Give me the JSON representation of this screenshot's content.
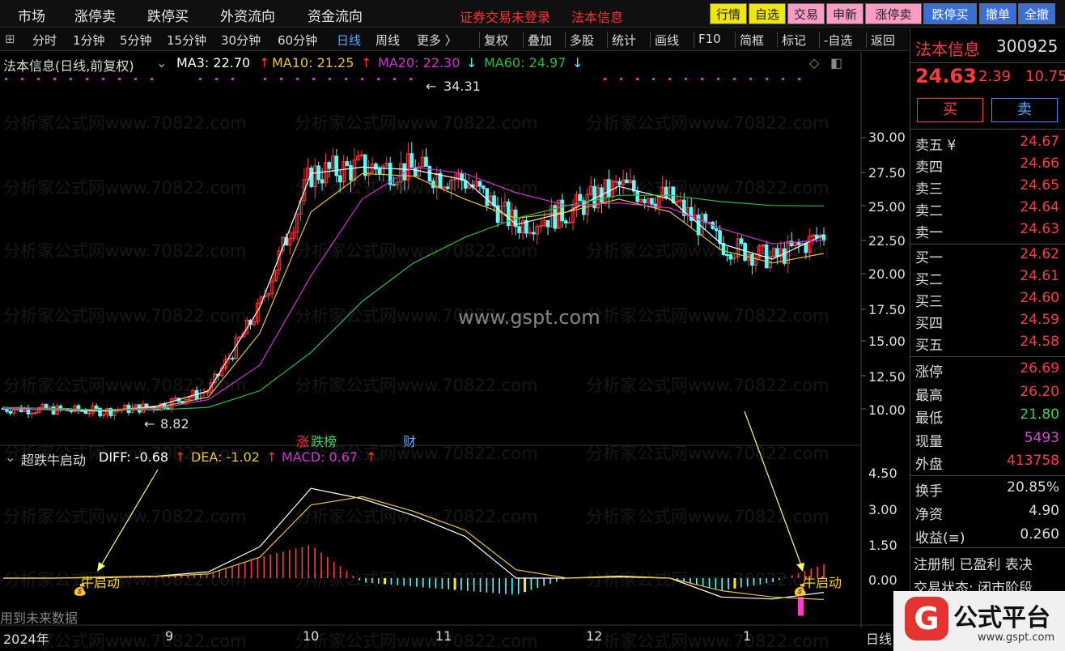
{
  "top_menu": [
    "市场",
    "涨停卖",
    "跌停买",
    "外资流向",
    "资金流向"
  ],
  "status": {
    "login": "证券交易未登录",
    "stock": "法本信息"
  },
  "top_buttons": [
    {
      "label": "行情",
      "color": "#222",
      "bg": "#f1e60a"
    },
    {
      "label": "自选",
      "color": "#222",
      "bg": "#f1e60a"
    },
    {
      "label": "交易",
      "color": "#222",
      "bg": "#ff9bc4"
    },
    {
      "label": "申新",
      "color": "#222",
      "bg": "#ff9bc4"
    },
    {
      "label": "涨停卖",
      "color": "#222",
      "bg": "#ff9bc4"
    },
    {
      "label": "跌停买",
      "color": "#fff",
      "bg": "#3a6fd8"
    },
    {
      "label": "撤单",
      "color": "#fff",
      "bg": "#3a6fd8"
    },
    {
      "label": "全撤",
      "color": "#fff",
      "bg": "#3a6fd8"
    }
  ],
  "toolbar": {
    "periods": [
      "分时",
      "1分钟",
      "5分钟",
      "15分钟",
      "30分钟",
      "60分钟",
      "日线",
      "周线",
      "更多 〉"
    ],
    "active": "日线",
    "tools": [
      "复权",
      "叠加",
      "多股",
      "统计",
      "画线",
      "F10",
      "简框",
      "标记",
      "-自选",
      "返回"
    ]
  },
  "chart_header": {
    "title": "法本信息(日线,前复权)",
    "ma3": "MA3: 22.70",
    "ma10": "MA10: 21.25",
    "ma20": "MA20: 22.30",
    "ma60": "MA60: 24.97"
  },
  "annotations": {
    "high": "34.31",
    "low": "8.82",
    "zdb_1": "涨",
    "zdb_2": "跌榜",
    "cai": "财",
    "bull_left": "牛启动",
    "bull_right": "牛启动",
    "future_note": "用到未来数据"
  },
  "macd_header": {
    "name": "超跌牛启动",
    "diff": "DIFF: -0.68",
    "dea": "DEA: -1.02",
    "macd": "MACD: 0.67"
  },
  "price_axis": [
    "30.00",
    "27.50",
    "25.00",
    "22.50",
    "20.00",
    "17.50",
    "15.00",
    "12.50",
    "10.00"
  ],
  "macd_axis": [
    "4.50",
    "3.00",
    "1.50",
    "0.00"
  ],
  "x_axis": [
    "2024年",
    "9",
    "10",
    "11",
    "12",
    "1"
  ],
  "period_label": "日线",
  "watermark_text": "分析家公式网www.70822.com",
  "center_watermark": "www.gspt.com",
  "right_panel": {
    "name": "法本信息",
    "code": "300925",
    "price": "24.63",
    "change": "2.39",
    "pct": "10.75",
    "buy_btn": "买",
    "sell_btn": "卖",
    "asks": [
      {
        "label": "卖五 ¥",
        "val": "24.67"
      },
      {
        "label": "卖四",
        "val": "24.66"
      },
      {
        "label": "卖三",
        "val": "24.65"
      },
      {
        "label": "卖二",
        "val": "24.64"
      },
      {
        "label": "卖一",
        "val": "24.63"
      }
    ],
    "bids": [
      {
        "label": "买一",
        "val": "24.62"
      },
      {
        "label": "买二",
        "val": "24.61"
      },
      {
        "label": "买三",
        "val": "24.60"
      },
      {
        "label": "买四",
        "val": "24.59"
      },
      {
        "label": "买五",
        "val": "24.58"
      }
    ],
    "stats": [
      {
        "label": "涨停",
        "val": "26.69",
        "color": "#ff3b3b"
      },
      {
        "label": "最高",
        "val": "26.20",
        "color": "#ff3b3b"
      },
      {
        "label": "最低",
        "val": "21.80",
        "color": "#2fd35a"
      },
      {
        "label": "现量",
        "val": "5493",
        "color": "#d24bd2"
      },
      {
        "label": "外盘",
        "val": "413758",
        "color": "#ff3b3b"
      }
    ],
    "stats2": [
      {
        "label": "换手",
        "val": "20.85%"
      },
      {
        "label": "净资",
        "val": "4.90"
      },
      {
        "label": "收益(≡)",
        "val": "0.260"
      }
    ],
    "reg": "注册制 已盈利 表决",
    "trade_state": "交易状态: 闭市阶段"
  },
  "logo": {
    "glyph": "G",
    "text": "公式平台",
    "url": "www.gspt.com"
  },
  "colors": {
    "up": "#ff3b3b",
    "down": "#54ffff",
    "ma3": "#ffffff",
    "ma10": "#e8c22a",
    "ma20": "#d12fd1",
    "ma60": "#1fbf3a"
  },
  "chart_data": [
    {
      "type": "line",
      "title": "法本信息(日线,前复权)",
      "ylim": [
        8,
        35
      ],
      "x": [
        "2024年",
        "9",
        "10",
        "11",
        "12",
        "1"
      ],
      "series": [
        {
          "name": "MA3",
          "values": [
            9.1,
            9.0,
            8.9,
            9.3,
            10.5,
            17.0,
            27.5,
            28.0,
            27.8,
            27.0,
            23.5,
            24.5,
            26.5,
            25.5,
            22.0,
            20.8,
            22.7
          ]
        },
        {
          "name": "MA10",
          "values": [
            9.1,
            9.0,
            9.0,
            9.2,
            10.0,
            15.0,
            24.5,
            27.5,
            27.3,
            25.5,
            24.0,
            24.5,
            25.5,
            24.5,
            21.5,
            20.5,
            21.25
          ]
        },
        {
          "name": "MA20",
          "values": [
            9.1,
            9.0,
            9.0,
            9.1,
            9.8,
            12.5,
            19.5,
            25.5,
            28.0,
            27.5,
            26.0,
            25.0,
            25.2,
            24.8,
            23.2,
            22.0,
            22.3
          ]
        },
        {
          "name": "MA60",
          "values": [
            9.2,
            9.1,
            9.0,
            9.0,
            9.2,
            10.5,
            13.5,
            17.5,
            20.5,
            22.5,
            24.0,
            25.0,
            25.8,
            25.8,
            25.3,
            25.0,
            24.97
          ]
        }
      ],
      "annotations": {
        "high": 34.31,
        "low": 8.82
      }
    },
    {
      "type": "line",
      "title": "超跌牛启动",
      "ylim": [
        -1.2,
        5
      ],
      "series": [
        {
          "name": "DIFF",
          "values": [
            0.0,
            0.0,
            0.05,
            0.1,
            0.3,
            1.5,
            4.3,
            3.8,
            3.0,
            2.0,
            0.0,
            0.0,
            0.1,
            0.0,
            -0.9,
            -1.0,
            -0.68
          ]
        },
        {
          "name": "DEA",
          "values": [
            0.0,
            0.0,
            0.03,
            0.08,
            0.2,
            1.0,
            3.5,
            3.9,
            3.2,
            2.3,
            0.4,
            0.0,
            0.05,
            0.0,
            -0.6,
            -0.9,
            -1.02
          ]
        },
        {
          "name": "MACD",
          "values": [
            0.0,
            0.0,
            0.04,
            0.04,
            0.2,
            1.0,
            1.6,
            -0.2,
            -0.4,
            -0.6,
            -0.8,
            0.0,
            0.1,
            0.0,
            -0.6,
            -0.2,
            0.67
          ]
        }
      ]
    }
  ]
}
